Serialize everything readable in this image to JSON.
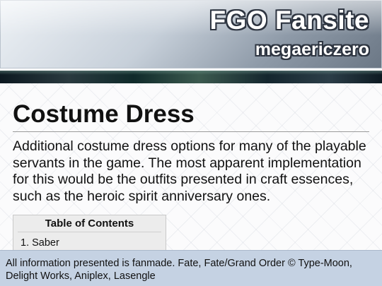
{
  "site": {
    "title": "FGO Fansite",
    "subtitle": "megaericzero"
  },
  "page": {
    "title": "Costume Dress",
    "intro": "Additional costume dress options for many of the playable servants in the game. The most apparent implementation for this would be the outfits presented in craft essences, such as the heroic spirit anniversary ones."
  },
  "toc": {
    "title": "Table of Contents",
    "items": [
      "1. Saber"
    ]
  },
  "footer": {
    "text": "All information presented is fanmade. Fate, Fate/Grand Order © Type-Moon, Delight Works, Aniplex, Lasengle"
  },
  "colors": {
    "footer_bg": "#c5d2e3",
    "header_text_outline": "#2d3440"
  }
}
